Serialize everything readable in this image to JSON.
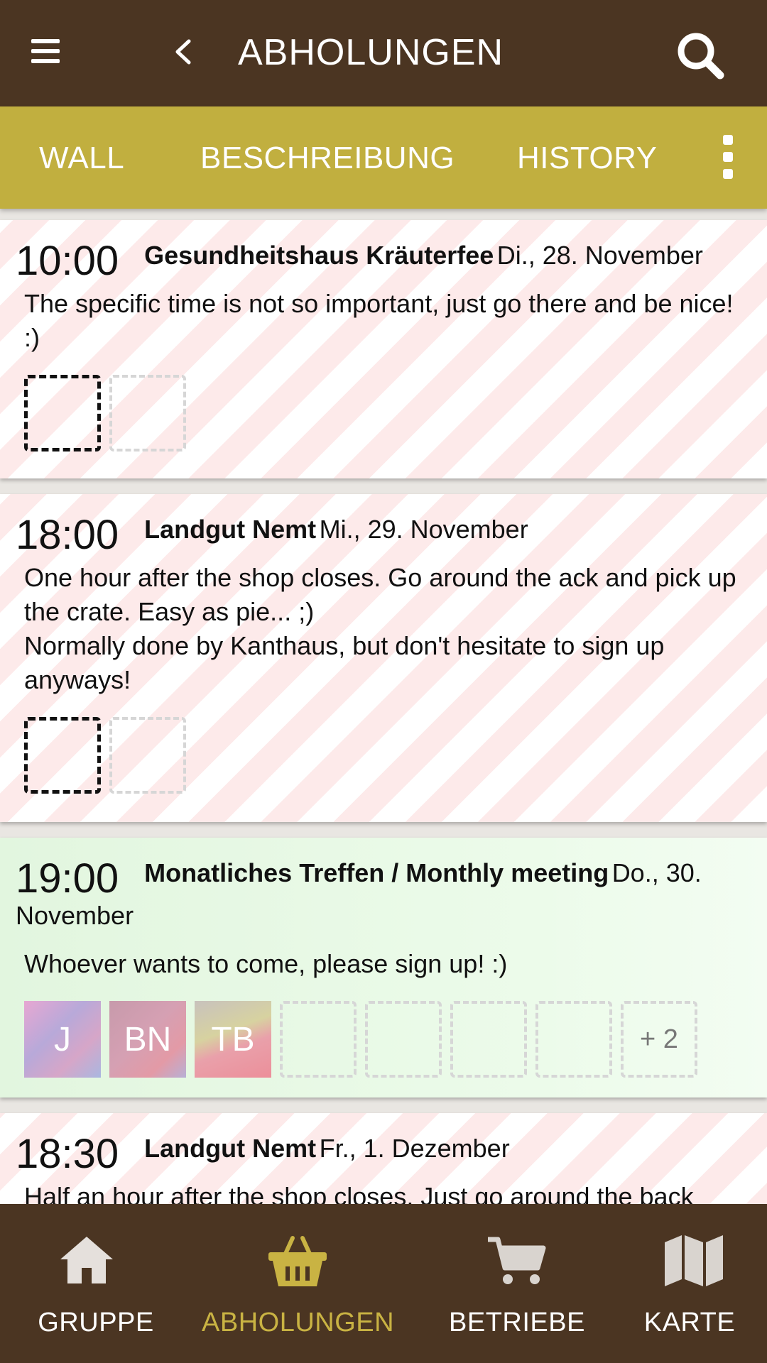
{
  "app_bar": {
    "title": "ABHOLUNGEN",
    "menu_icon": "hamburger-menu-icon",
    "back_icon": "chevron-left-icon",
    "search_icon": "search-icon"
  },
  "tabs": [
    {
      "label": "WALL"
    },
    {
      "label": "BESCHREIBUNG"
    },
    {
      "label": "HISTORY"
    }
  ],
  "tabs_more_icon": "vertical-dots-icon",
  "pickups": [
    {
      "time": "10:00",
      "place": "Gesundheitshaus Kräuterfee",
      "date": "Di., 28. November",
      "description": [
        "The specific time is not so important, just go there and be nice! :)"
      ],
      "style": "striped"
    },
    {
      "time": "18:00",
      "place": "Landgut Nemt",
      "date": "Mi., 29. November",
      "description": [
        "One hour after the shop closes. Go around the ack and pick up the crate. Easy as pie... ;)",
        "Normally done by Kanthaus, but don't hesitate to sign up anyways!"
      ],
      "style": "striped"
    },
    {
      "time": "19:00",
      "place": "Monatliches Treffen / Monthly meeting",
      "date": "Do., 30. November",
      "description": [
        "Whoever wants to come, please sign up! :)"
      ],
      "style": "green",
      "avatars": [
        "J",
        "BN",
        "TB"
      ],
      "more_count": "+ 2"
    },
    {
      "time": "18:30",
      "place": "Landgut Nemt",
      "date": "Fr., 1. Dezember",
      "description": [
        "Half an hour after the shop closes.  Just go around the back"
      ],
      "style": "striped"
    }
  ],
  "bottom_nav": [
    {
      "label": "GRUPPE",
      "icon": "home-icon",
      "active": false
    },
    {
      "label": "ABHOLUNGEN",
      "icon": "basket-icon",
      "active": true
    },
    {
      "label": "BETRIEBE",
      "icon": "cart-icon",
      "active": false
    },
    {
      "label": "KARTE",
      "icon": "map-icon",
      "active": false
    }
  ],
  "colors": {
    "primary_brown": "#4b3522",
    "accent_olive": "#c1af3f",
    "active_nav": "#c9b343",
    "stripe_pink": "#fdeaea",
    "joined_green": "#e2f6df"
  }
}
